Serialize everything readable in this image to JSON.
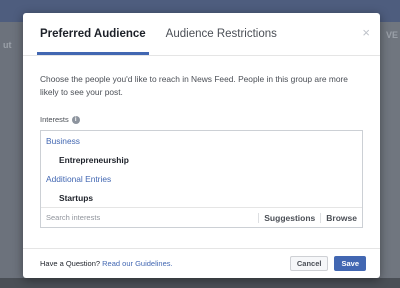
{
  "background": {
    "left_fragment": "ut",
    "right_fragment": "VE"
  },
  "tabs": [
    {
      "label": "Preferred Audience",
      "active": true
    },
    {
      "label": "Audience Restrictions",
      "active": false
    }
  ],
  "close_symbol": "×",
  "description": "Choose the people you'd like to reach in News Feed. People in this group are more likely to see your post.",
  "interests": {
    "label": "Interests",
    "info_symbol": "i",
    "categories": [
      {
        "name": "Business",
        "items": [
          "Entrepreneurship"
        ]
      },
      {
        "name": "Additional Entries",
        "items": [
          "Startups"
        ]
      }
    ],
    "search_placeholder": "Search interests",
    "suggestions_label": "Suggestions",
    "browse_label": "Browse"
  },
  "footer": {
    "help_prefix": "Have a Question?",
    "help_link": "Read our Guidelines.",
    "cancel_label": "Cancel",
    "save_label": "Save"
  },
  "colors": {
    "accent": "#4267b2",
    "text": "#1d2129",
    "muted": "#4b4f56"
  }
}
